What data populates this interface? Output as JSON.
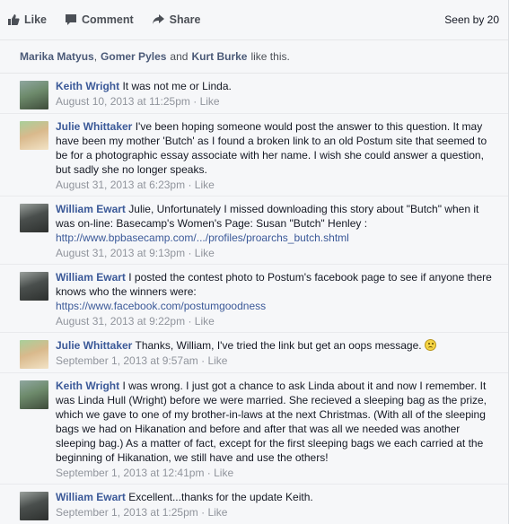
{
  "actions": {
    "like_label": "Like",
    "comment_label": "Comment",
    "share_label": "Share",
    "seen_by": "Seen by 20"
  },
  "likes": {
    "users": [
      "Marika Matyus",
      "Gomer Pyles",
      "Kurt Burke"
    ],
    "sep1": ",",
    "and": "and",
    "suffix": "like this."
  },
  "comments": [
    {
      "author": "Keith Wright",
      "text": "It was not me or Linda.",
      "timestamp": "August 10, 2013 at 11:25pm",
      "like": "Like",
      "avatar_colors": [
        "#6d8a6b",
        "#8fa7a0",
        "#3e4c3a"
      ]
    },
    {
      "author": "Julie Whittaker",
      "text": "I've been hoping someone would post the answer to this question. It may have been my mother 'Butch' as I found a broken link to an old Postum site that seemed to be for a photographic essay associate with her name. I wish she could answer a question, but sadly she no longer speaks.",
      "timestamp": "August 31, 2013 at 6:23pm",
      "like": "Like",
      "avatar_colors": [
        "#d9b98c",
        "#a8cf9a",
        "#f2e3c6"
      ]
    },
    {
      "author": "William Ewart",
      "text": "Julie, Unfortunately I missed downloading this story about \"Butch\" when it was on-line: Basecamp's Women's Page: Susan \"Butch\" Henley :",
      "link": "http://www.bpbasecamp.com/.../profiles/proarchs_butch.shtml",
      "timestamp": "August 31, 2013 at 9:13pm",
      "like": "Like",
      "avatar_colors": [
        "#4a4f4d",
        "#9aa09c",
        "#2d302e"
      ]
    },
    {
      "author": "William Ewart",
      "text": "I posted the contest photo to Postum's facebook page to see if anyone there knows who the winners were:",
      "link": "https://www.facebook.com/postumgoodness",
      "timestamp": "August 31, 2013 at 9:22pm",
      "like": "Like",
      "avatar_colors": [
        "#4a4f4d",
        "#9aa09c",
        "#2d302e"
      ]
    },
    {
      "author": "Julie Whittaker",
      "text": "Thanks, William, I've tried the link but get an oops message.",
      "emoji": "frown-emoji",
      "timestamp": "September 1, 2013 at 9:57am",
      "like": "Like",
      "avatar_colors": [
        "#d9b98c",
        "#a8cf9a",
        "#f2e3c6"
      ]
    },
    {
      "author": "Keith Wright",
      "text": "I was wrong. I just got a chance to ask Linda about it and now I remember. It was Linda Hull (Wright) before we were married. She recieved a sleeping bag as the prize, which we gave to one of my brother-in-laws at the next Christmas. (With all of the sleeping bags we had on Hikanation and before and after that was all we needed was another sleeping bag.) As a matter of fact, except for the first sleeping bags we each carried at the beginning of Hikanation, we still have and use the others!",
      "timestamp": "September 1, 2013 at 12:41pm",
      "like": "Like",
      "avatar_colors": [
        "#6d8a6b",
        "#8fa7a0",
        "#3e4c3a"
      ]
    },
    {
      "author": "William Ewart",
      "text": "Excellent...thanks for the update Keith.",
      "timestamp": "September 1, 2013 at 1:25pm",
      "like": "Like",
      "avatar_colors": [
        "#4a4f4d",
        "#9aa09c",
        "#2d302e"
      ]
    }
  ]
}
